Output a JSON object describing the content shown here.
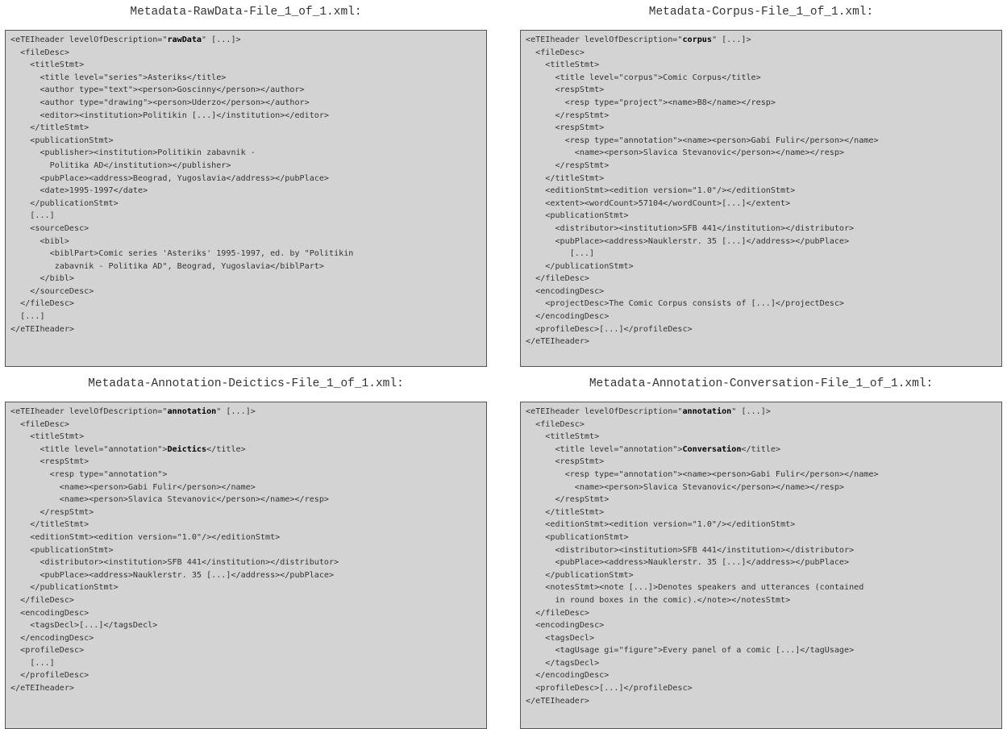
{
  "panels": [
    {
      "caption": "Metadata-RawData-File_1_of_1.xml:",
      "lines": [
        [
          {
            "t": "<eTEIheader levelOfDescription=\""
          },
          {
            "t": "rawData",
            "b": true
          },
          {
            "t": "\" [...]>"
          }
        ],
        [
          {
            "t": "  <fileDesc>"
          }
        ],
        [
          {
            "t": "    <titleStmt>"
          }
        ],
        [
          {
            "t": "      <title level=\"series\">Asteriks</title>"
          }
        ],
        [
          {
            "t": "      <author type=\"text\"><person>Goscinny</person></author>"
          }
        ],
        [
          {
            "t": "      <author type=\"drawing\"><person>Uderzo</person></author>"
          }
        ],
        [
          {
            "t": "      <editor><institution>Politikin [...]</institution></editor>"
          }
        ],
        [
          {
            "t": "    </titleStmt>"
          }
        ],
        [
          {
            "t": "    <publicationStmt>"
          }
        ],
        [
          {
            "t": "      <publisher><institution>Politikin zabavnik -"
          }
        ],
        [
          {
            "t": "        Politika AD</institution></publisher>"
          }
        ],
        [
          {
            "t": "      <pubPlace><address>Beograd, Yugoslavia</address></pubPlace>"
          }
        ],
        [
          {
            "t": "      <date>1995-1997</date>"
          }
        ],
        [
          {
            "t": "    </publicationStmt>"
          }
        ],
        [
          {
            "t": "    [...]"
          }
        ],
        [
          {
            "t": "    <sourceDesc>"
          }
        ],
        [
          {
            "t": "      <bibl>"
          }
        ],
        [
          {
            "t": "        <biblPart>Comic series 'Asteriks' 1995-1997, ed. by \"Politikin"
          }
        ],
        [
          {
            "t": "         zabavnik - Politika AD\", Beograd, Yugoslavia</biblPart>"
          }
        ],
        [
          {
            "t": "      </bibl>"
          }
        ],
        [
          {
            "t": "    </sourceDesc>"
          }
        ],
        [
          {
            "t": "  </fileDesc>"
          }
        ],
        [
          {
            "t": "  [...]"
          }
        ],
        [
          {
            "t": "</eTEIheader>"
          }
        ]
      ]
    },
    {
      "caption": "Metadata-Corpus-File_1_of_1.xml:",
      "lines": [
        [
          {
            "t": "<eTEIheader levelOfDescription=\""
          },
          {
            "t": "corpus",
            "b": true
          },
          {
            "t": "\" [...]>"
          }
        ],
        [
          {
            "t": "  <fileDesc>"
          }
        ],
        [
          {
            "t": "    <titleStmt>"
          }
        ],
        [
          {
            "t": "      <title level=\"corpus\">Comic Corpus</title>"
          }
        ],
        [
          {
            "t": "      <respStmt>"
          }
        ],
        [
          {
            "t": "        <resp type=\"project\"><name>B8</name></resp>"
          }
        ],
        [
          {
            "t": "      </respStmt>"
          }
        ],
        [
          {
            "t": "      <respStmt>"
          }
        ],
        [
          {
            "t": "        <resp type=\"annotation\"><name><person>Gabi Fulir</person></name>"
          }
        ],
        [
          {
            "t": "          <name><person>Slavica Stevanovic</person></name></resp>"
          }
        ],
        [
          {
            "t": "      </respStmt>"
          }
        ],
        [
          {
            "t": "    </titleStmt>"
          }
        ],
        [
          {
            "t": "    <editionStmt><edition version=\"1.0\"/></editionStmt>"
          }
        ],
        [
          {
            "t": "    <extent><wordCount>57104</wordCount>[...]</extent>"
          }
        ],
        [
          {
            "t": "    <publicationStmt>"
          }
        ],
        [
          {
            "t": "      <distributor><institution>SFB 441</institution></distributor>"
          }
        ],
        [
          {
            "t": "      <pubPlace><address>Nauklerstr. 35 [...]</address></pubPlace>"
          }
        ],
        [
          {
            "t": "         [...]"
          }
        ],
        [
          {
            "t": "    </publicationStmt>"
          }
        ],
        [
          {
            "t": "  </fileDesc>"
          }
        ],
        [
          {
            "t": "  <encodingDesc>"
          }
        ],
        [
          {
            "t": "    <projectDesc>The Comic Corpus consists of [...]</projectDesc>"
          }
        ],
        [
          {
            "t": "  </encodingDesc>"
          }
        ],
        [
          {
            "t": "  <profileDesc>[...]</profileDesc>"
          }
        ],
        [
          {
            "t": "</eTEIheader>"
          }
        ]
      ]
    },
    {
      "caption": "Metadata-Annotation-Deictics-File_1_of_1.xml:",
      "lines": [
        [
          {
            "t": "<eTEIheader levelOfDescription=\""
          },
          {
            "t": "annotation",
            "b": true
          },
          {
            "t": "\" [...]>"
          }
        ],
        [
          {
            "t": "  <fileDesc>"
          }
        ],
        [
          {
            "t": "    <titleStmt>"
          }
        ],
        [
          {
            "t": "      <title level=\"annotation\">"
          },
          {
            "t": "Deictics",
            "b": true
          },
          {
            "t": "</title>"
          }
        ],
        [
          {
            "t": "      <respStmt>"
          }
        ],
        [
          {
            "t": "        <resp type=\"annotation\">"
          }
        ],
        [
          {
            "t": "          <name><person>Gabi Fulir</person></name>"
          }
        ],
        [
          {
            "t": "          <name><person>Slavica Stevanovic</person></name></resp>"
          }
        ],
        [
          {
            "t": "      </respStmt>"
          }
        ],
        [
          {
            "t": "    </titleStmt>"
          }
        ],
        [
          {
            "t": "    <editionStmt><edition version=\"1.0\"/></editionStmt>"
          }
        ],
        [
          {
            "t": "    <publicationStmt>"
          }
        ],
        [
          {
            "t": "      <distributor><institution>SFB 441</institution></distributor>"
          }
        ],
        [
          {
            "t": "      <pubPlace><address>Nauklerstr. 35 [...]</address></pubPlace>"
          }
        ],
        [
          {
            "t": "    </publicationStmt>"
          }
        ],
        [
          {
            "t": "  </fileDesc>"
          }
        ],
        [
          {
            "t": "  <encodingDesc>"
          }
        ],
        [
          {
            "t": "    <tagsDecl>[...]</tagsDecl>"
          }
        ],
        [
          {
            "t": "  </encodingDesc>"
          }
        ],
        [
          {
            "t": "  <profileDesc>"
          }
        ],
        [
          {
            "t": "    [...]"
          }
        ],
        [
          {
            "t": "  </profileDesc>"
          }
        ],
        [
          {
            "t": "</eTEIheader>"
          }
        ]
      ]
    },
    {
      "caption": "Metadata-Annotation-Conversation-File_1_of_1.xml:",
      "lines": [
        [
          {
            "t": "<eTEIheader levelOfDescription=\""
          },
          {
            "t": "annotation",
            "b": true
          },
          {
            "t": "\" [...]>"
          }
        ],
        [
          {
            "t": "  <fileDesc>"
          }
        ],
        [
          {
            "t": "    <titleStmt>"
          }
        ],
        [
          {
            "t": "      <title level=\"annotation\">"
          },
          {
            "t": "Conversation",
            "b": true
          },
          {
            "t": "</title>"
          }
        ],
        [
          {
            "t": "      <respStmt>"
          }
        ],
        [
          {
            "t": "        <resp type=\"annotation\"><name><person>Gabi Fulir</person></name>"
          }
        ],
        [
          {
            "t": "          <name><person>Slavica Stevanovic</person></name></resp>"
          }
        ],
        [
          {
            "t": "      </respStmt>"
          }
        ],
        [
          {
            "t": "    </titleStmt>"
          }
        ],
        [
          {
            "t": "    <editionStmt><edition version=\"1.0\"/></editionStmt>"
          }
        ],
        [
          {
            "t": "    <publicationStmt>"
          }
        ],
        [
          {
            "t": "      <distributor><institution>SFB 441</institution></distributor>"
          }
        ],
        [
          {
            "t": "      <pubPlace><address>Nauklerstr. 35 [...]</address></pubPlace>"
          }
        ],
        [
          {
            "t": "    </publicationStmt>"
          }
        ],
        [
          {
            "t": "    <notesStmt><note [...]>Denotes speakers and utterances (contained"
          }
        ],
        [
          {
            "t": "      in round boxes in the comic).</note></notesStmt>"
          }
        ],
        [
          {
            "t": "  </fileDesc>"
          }
        ],
        [
          {
            "t": "  <encodingDesc>"
          }
        ],
        [
          {
            "t": "    <tagsDecl>"
          }
        ],
        [
          {
            "t": "      <tagUsage gi=\"figure\">Every panel of a comic [...]</tagUsage>"
          }
        ],
        [
          {
            "t": "    </tagsDecl>"
          }
        ],
        [
          {
            "t": "  </encodingDesc>"
          }
        ],
        [
          {
            "t": "  <profileDesc>[...]</profileDesc>"
          }
        ],
        [
          {
            "t": "</eTEIheader>"
          }
        ]
      ]
    }
  ]
}
